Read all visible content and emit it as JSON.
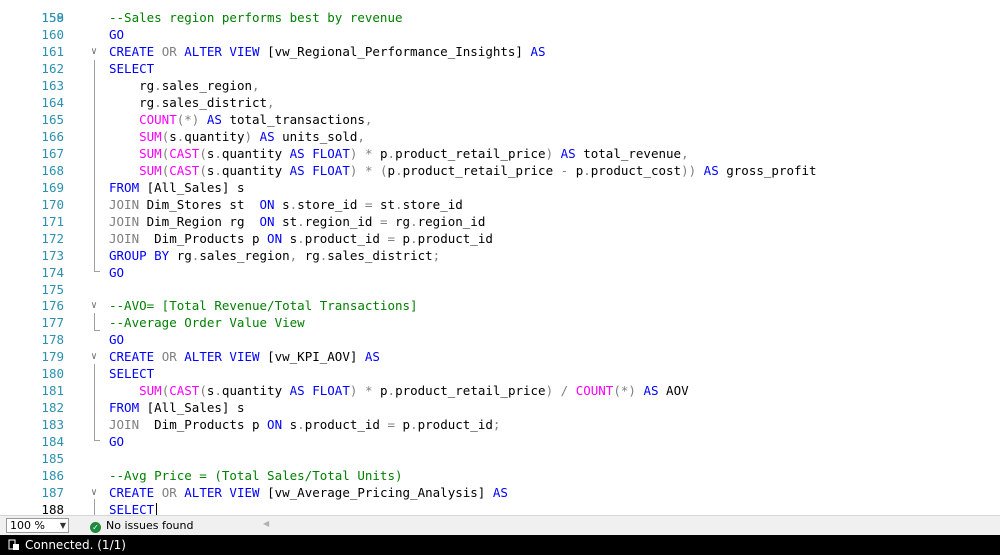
{
  "editor": {
    "partial_top_line_number": "158",
    "lines": [
      {
        "n": "159",
        "fold": "",
        "tokens": [
          [
            "cm",
            "--Sales region performs best by revenue"
          ]
        ]
      },
      {
        "n": "160",
        "fold": "",
        "tokens": [
          [
            "kw",
            "GO"
          ]
        ]
      },
      {
        "n": "161",
        "fold": "v",
        "tokens": [
          [
            "kw",
            "CREATE"
          ],
          [
            "id",
            " "
          ],
          [
            "op",
            "OR"
          ],
          [
            "id",
            " "
          ],
          [
            "kw",
            "ALTER VIEW"
          ],
          [
            "id",
            " [vw_Regional_Performance_Insights] "
          ],
          [
            "kw",
            "AS"
          ]
        ]
      },
      {
        "n": "162",
        "fold": "",
        "tokens": [
          [
            "kw",
            "SELECT"
          ]
        ]
      },
      {
        "n": "163",
        "fold": "",
        "tokens": [
          [
            "id",
            "    rg"
          ],
          [
            "op",
            "."
          ],
          [
            "id",
            "sales_region"
          ],
          [
            "op",
            ","
          ]
        ]
      },
      {
        "n": "164",
        "fold": "",
        "tokens": [
          [
            "id",
            "    rg"
          ],
          [
            "op",
            "."
          ],
          [
            "id",
            "sales_district"
          ],
          [
            "op",
            ","
          ]
        ]
      },
      {
        "n": "165",
        "fold": "",
        "tokens": [
          [
            "id",
            "    "
          ],
          [
            "fn",
            "COUNT"
          ],
          [
            "op",
            "(*)"
          ],
          [
            "id",
            " "
          ],
          [
            "kw",
            "AS"
          ],
          [
            "id",
            " total_transactions"
          ],
          [
            "op",
            ","
          ]
        ]
      },
      {
        "n": "166",
        "fold": "",
        "tokens": [
          [
            "id",
            "    "
          ],
          [
            "fn",
            "SUM"
          ],
          [
            "op",
            "("
          ],
          [
            "id",
            "s"
          ],
          [
            "op",
            "."
          ],
          [
            "id",
            "quantity"
          ],
          [
            "op",
            ")"
          ],
          [
            "id",
            " "
          ],
          [
            "kw",
            "AS"
          ],
          [
            "id",
            " units_sold"
          ],
          [
            "op",
            ","
          ]
        ]
      },
      {
        "n": "167",
        "fold": "",
        "tokens": [
          [
            "id",
            "    "
          ],
          [
            "fn",
            "SUM"
          ],
          [
            "op",
            "("
          ],
          [
            "fn",
            "CAST"
          ],
          [
            "op",
            "("
          ],
          [
            "id",
            "s"
          ],
          [
            "op",
            "."
          ],
          [
            "id",
            "quantity "
          ],
          [
            "kw",
            "AS FLOAT"
          ],
          [
            "op",
            ")"
          ],
          [
            "id",
            " "
          ],
          [
            "op",
            "*"
          ],
          [
            "id",
            " p"
          ],
          [
            "op",
            "."
          ],
          [
            "id",
            "product_retail_price"
          ],
          [
            "op",
            ")"
          ],
          [
            "id",
            " "
          ],
          [
            "kw",
            "AS"
          ],
          [
            "id",
            " total_revenue"
          ],
          [
            "op",
            ","
          ]
        ]
      },
      {
        "n": "168",
        "fold": "",
        "tokens": [
          [
            "id",
            "    "
          ],
          [
            "fn",
            "SUM"
          ],
          [
            "op",
            "("
          ],
          [
            "fn",
            "CAST"
          ],
          [
            "op",
            "("
          ],
          [
            "id",
            "s"
          ],
          [
            "op",
            "."
          ],
          [
            "id",
            "quantity "
          ],
          [
            "kw",
            "AS FLOAT"
          ],
          [
            "op",
            ")"
          ],
          [
            "id",
            " "
          ],
          [
            "op",
            "*"
          ],
          [
            "id",
            " "
          ],
          [
            "op",
            "("
          ],
          [
            "id",
            "p"
          ],
          [
            "op",
            "."
          ],
          [
            "id",
            "product_retail_price "
          ],
          [
            "op",
            "-"
          ],
          [
            "id",
            " p"
          ],
          [
            "op",
            "."
          ],
          [
            "id",
            "product_cost"
          ],
          [
            "op",
            "))"
          ],
          [
            "id",
            " "
          ],
          [
            "kw",
            "AS"
          ],
          [
            "id",
            " gross_profit"
          ]
        ]
      },
      {
        "n": "169",
        "fold": "",
        "tokens": [
          [
            "kw",
            "FROM"
          ],
          [
            "id",
            " [All_Sales] s"
          ]
        ]
      },
      {
        "n": "170",
        "fold": "",
        "tokens": [
          [
            "op",
            "JOIN"
          ],
          [
            "id",
            " Dim_Stores st  "
          ],
          [
            "kw",
            "ON"
          ],
          [
            "id",
            " s"
          ],
          [
            "op",
            "."
          ],
          [
            "id",
            "store_id "
          ],
          [
            "op",
            "="
          ],
          [
            "id",
            " st"
          ],
          [
            "op",
            "."
          ],
          [
            "id",
            "store_id"
          ]
        ]
      },
      {
        "n": "171",
        "fold": "",
        "tokens": [
          [
            "op",
            "JOIN"
          ],
          [
            "id",
            " Dim_Region rg  "
          ],
          [
            "kw",
            "ON"
          ],
          [
            "id",
            " st"
          ],
          [
            "op",
            "."
          ],
          [
            "id",
            "region_id "
          ],
          [
            "op",
            "="
          ],
          [
            "id",
            " rg"
          ],
          [
            "op",
            "."
          ],
          [
            "id",
            "region_id"
          ]
        ]
      },
      {
        "n": "172",
        "fold": "",
        "tokens": [
          [
            "op",
            "JOIN"
          ],
          [
            "id",
            "  Dim_Products p "
          ],
          [
            "kw",
            "ON"
          ],
          [
            "id",
            " s"
          ],
          [
            "op",
            "."
          ],
          [
            "id",
            "product_id "
          ],
          [
            "op",
            "="
          ],
          [
            "id",
            " p"
          ],
          [
            "op",
            "."
          ],
          [
            "id",
            "product_id"
          ]
        ]
      },
      {
        "n": "173",
        "fold": "",
        "tokens": [
          [
            "kw",
            "GROUP BY"
          ],
          [
            "id",
            " rg"
          ],
          [
            "op",
            "."
          ],
          [
            "id",
            "sales_region"
          ],
          [
            "op",
            ","
          ],
          [
            "id",
            " rg"
          ],
          [
            "op",
            "."
          ],
          [
            "id",
            "sales_district"
          ],
          [
            "op",
            ";"
          ]
        ]
      },
      {
        "n": "174",
        "fold": "",
        "tokens": [
          [
            "kw",
            "GO"
          ]
        ]
      },
      {
        "n": "175",
        "fold": "",
        "tokens": []
      },
      {
        "n": "176",
        "fold": "v",
        "tokens": [
          [
            "cm",
            "--AVO= [Total Revenue/Total Transactions]"
          ]
        ]
      },
      {
        "n": "177",
        "fold": "",
        "tokens": [
          [
            "cm",
            "--Average Order Value View"
          ]
        ]
      },
      {
        "n": "178",
        "fold": "",
        "tokens": [
          [
            "kw",
            "GO"
          ]
        ]
      },
      {
        "n": "179",
        "fold": "v",
        "tokens": [
          [
            "kw",
            "CREATE"
          ],
          [
            "id",
            " "
          ],
          [
            "op",
            "OR"
          ],
          [
            "id",
            " "
          ],
          [
            "kw",
            "ALTER VIEW"
          ],
          [
            "id",
            " [vw_KPI_AOV] "
          ],
          [
            "kw",
            "AS"
          ]
        ]
      },
      {
        "n": "180",
        "fold": "",
        "tokens": [
          [
            "kw",
            "SELECT"
          ]
        ]
      },
      {
        "n": "181",
        "fold": "",
        "tokens": [
          [
            "id",
            "    "
          ],
          [
            "fn",
            "SUM"
          ],
          [
            "op",
            "("
          ],
          [
            "fn",
            "CAST"
          ],
          [
            "op",
            "("
          ],
          [
            "id",
            "s"
          ],
          [
            "op",
            "."
          ],
          [
            "id",
            "quantity "
          ],
          [
            "kw",
            "AS FLOAT"
          ],
          [
            "op",
            ")"
          ],
          [
            "id",
            " "
          ],
          [
            "op",
            "*"
          ],
          [
            "id",
            " p"
          ],
          [
            "op",
            "."
          ],
          [
            "id",
            "product_retail_price"
          ],
          [
            "op",
            ")"
          ],
          [
            "id",
            " "
          ],
          [
            "op",
            "/"
          ],
          [
            "id",
            " "
          ],
          [
            "fn",
            "COUNT"
          ],
          [
            "op",
            "(*)"
          ],
          [
            "id",
            " "
          ],
          [
            "kw",
            "AS"
          ],
          [
            "id",
            " AOV"
          ]
        ]
      },
      {
        "n": "182",
        "fold": "",
        "tokens": [
          [
            "kw",
            "FROM"
          ],
          [
            "id",
            " [All_Sales] s"
          ]
        ]
      },
      {
        "n": "183",
        "fold": "",
        "tokens": [
          [
            "op",
            "JOIN"
          ],
          [
            "id",
            "  Dim_Products p "
          ],
          [
            "kw",
            "ON"
          ],
          [
            "id",
            " s"
          ],
          [
            "op",
            "."
          ],
          [
            "id",
            "product_id "
          ],
          [
            "op",
            "="
          ],
          [
            "id",
            " p"
          ],
          [
            "op",
            "."
          ],
          [
            "id",
            "product_id"
          ],
          [
            "op",
            ";"
          ]
        ]
      },
      {
        "n": "184",
        "fold": "",
        "tokens": [
          [
            "kw",
            "GO"
          ]
        ]
      },
      {
        "n": "185",
        "fold": "",
        "tokens": []
      },
      {
        "n": "186",
        "fold": "",
        "tokens": [
          [
            "cm",
            "--Avg Price = (Total Sales/Total Units)"
          ]
        ]
      },
      {
        "n": "187",
        "fold": "v",
        "tokens": [
          [
            "kw",
            "CREATE"
          ],
          [
            "id",
            " "
          ],
          [
            "op",
            "OR"
          ],
          [
            "id",
            " "
          ],
          [
            "kw",
            "ALTER VIEW"
          ],
          [
            "id",
            " [vw_Average_Pricing_Analysis] "
          ],
          [
            "kw",
            "AS"
          ]
        ]
      },
      {
        "n": "188",
        "fold": "",
        "tokens": [
          [
            "kw",
            "SELECT"
          ]
        ],
        "current": true
      }
    ]
  },
  "status": {
    "zoom": "100 %",
    "issues": "No issues found"
  },
  "connection": {
    "text": "Connected. (1/1)"
  },
  "colors": {
    "keyword": "#0000ff",
    "function": "#ff00ff",
    "comment": "#008000",
    "operator": "#808080",
    "line_number": "#2b91af"
  }
}
